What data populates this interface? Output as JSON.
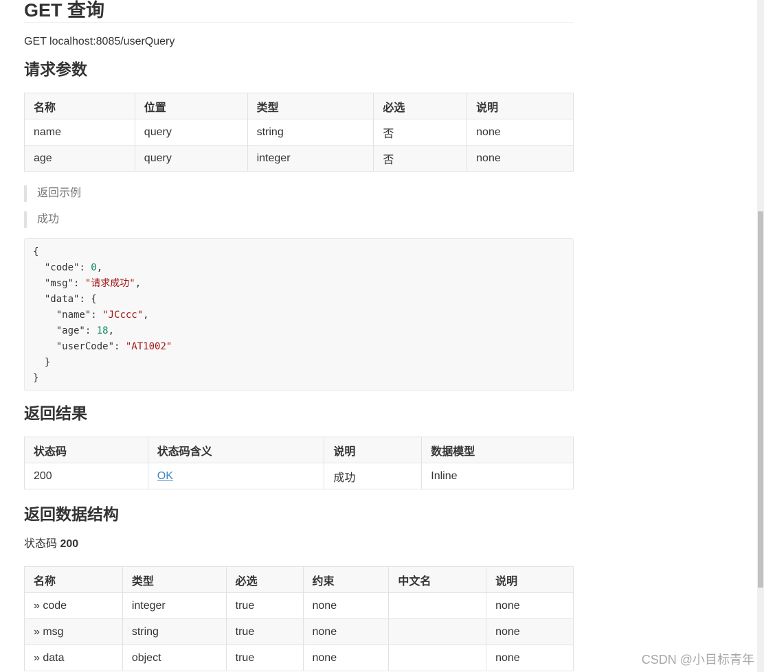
{
  "title": "GET 查询",
  "endpoint": "GET localhost:8085/userQuery",
  "params_heading": "请求参数",
  "params_table": {
    "headers": [
      "名称",
      "位置",
      "类型",
      "必选",
      "说明"
    ],
    "rows": [
      [
        "name",
        "query",
        "string",
        "否",
        "none"
      ],
      [
        "age",
        "query",
        "integer",
        "否",
        "none"
      ]
    ]
  },
  "example_label": "返回示例",
  "success_label": "成功",
  "code_sample": {
    "open": "{",
    "code_key": "\"code\"",
    "code_val": "0",
    "msg_key": "\"msg\"",
    "msg_val": "\"请求成功\"",
    "data_key": "\"data\"",
    "name_key": "\"name\"",
    "name_val": "\"JCccc\"",
    "age_key": "\"age\"",
    "age_val": "18",
    "usercode_key": "\"userCode\"",
    "usercode_val": "\"AT1002\"",
    "inner_close": "}",
    "close": "}"
  },
  "result_heading": "返回结果",
  "result_table": {
    "headers": [
      "状态码",
      "状态码含义",
      "说明",
      "数据模型"
    ],
    "rows": [
      [
        "200",
        "OK",
        "成功",
        "Inline"
      ]
    ]
  },
  "struct_heading": "返回数据结构",
  "status_prefix": "状态码",
  "status_code": "200",
  "struct_table": {
    "headers": [
      "名称",
      "类型",
      "必选",
      "约束",
      "中文名",
      "说明"
    ],
    "rows": [
      [
        "» code",
        "integer",
        "true",
        "none",
        "",
        "none"
      ],
      [
        "» msg",
        "string",
        "true",
        "none",
        "",
        "none"
      ],
      [
        "» data",
        "object",
        "true",
        "none",
        "",
        "none"
      ]
    ]
  },
  "watermark": "CSDN @小目标青年"
}
